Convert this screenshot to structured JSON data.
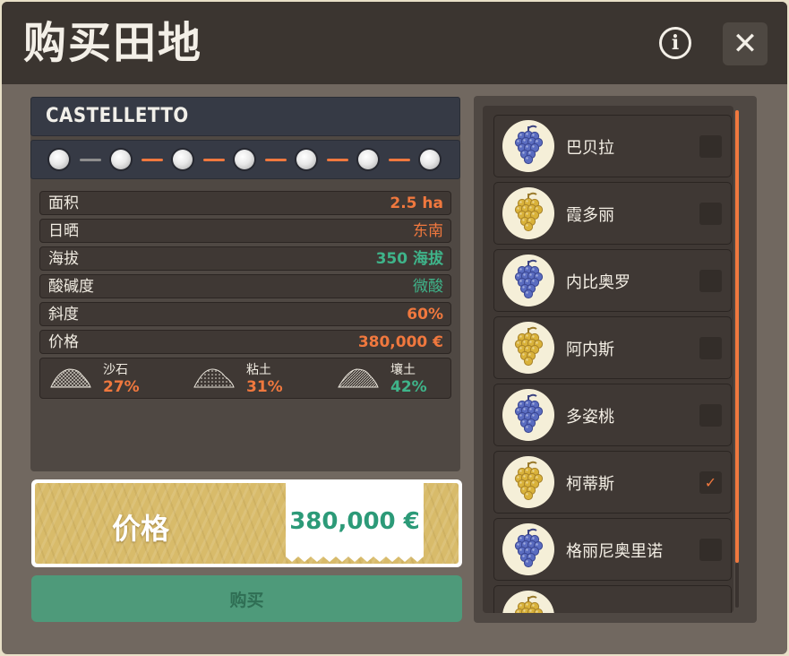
{
  "dialog": {
    "title": "购买田地",
    "info_icon": "info-icon",
    "close_icon": "close-icon"
  },
  "field": {
    "name": "CASTELLETTO",
    "progress_steps": 7
  },
  "properties": [
    {
      "label": "面积",
      "value": "2.5 ha",
      "color": "#f0783e"
    },
    {
      "label": "日晒",
      "value": "东南",
      "color": "#f0783e"
    },
    {
      "label": "海拔",
      "value": "350 海拔",
      "color": "#3fb48a"
    },
    {
      "label": "酸碱度",
      "value": "微酸",
      "color": "#3fb48a"
    },
    {
      "label": "斜度",
      "value": "60%",
      "color": "#f0783e"
    },
    {
      "label": "价格",
      "value": "380,000 €",
      "color": "#f0783e"
    }
  ],
  "soils": [
    {
      "name": "沙石",
      "percent": "27%",
      "color": "#f0783e",
      "icon": "gravel-pile-icon"
    },
    {
      "name": "粘土",
      "percent": "31%",
      "color": "#f0783e",
      "icon": "clay-pile-icon"
    },
    {
      "name": "壤土",
      "percent": "42%",
      "color": "#3fb48a",
      "icon": "loam-pile-icon"
    }
  ],
  "price_panel": {
    "label": "价格",
    "value": "380,000 €"
  },
  "buy_button": {
    "label": "购买"
  },
  "grapes": [
    {
      "name": "巴贝拉",
      "color": "blue",
      "checked": false
    },
    {
      "name": "霞多丽",
      "color": "white",
      "checked": false
    },
    {
      "name": "内比奥罗",
      "color": "blue",
      "checked": false
    },
    {
      "name": "阿内斯",
      "color": "white",
      "checked": false
    },
    {
      "name": "多姿桃",
      "color": "blue",
      "checked": false
    },
    {
      "name": "柯蒂斯",
      "color": "white",
      "checked": true
    },
    {
      "name": "格丽尼奥里诺",
      "color": "blue",
      "checked": false
    },
    {
      "name": "",
      "color": "white",
      "checked": false
    }
  ],
  "colors": {
    "accent_orange": "#f0783e",
    "accent_green": "#3fb48a",
    "grape_blue": "#5a6cc0",
    "grape_white": "#d9b23a"
  }
}
